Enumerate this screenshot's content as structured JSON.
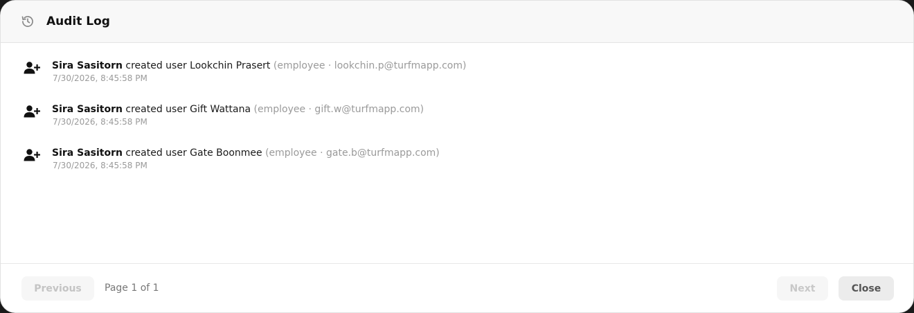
{
  "header": {
    "title": "Audit Log",
    "icon": "history-icon"
  },
  "entries": [
    {
      "icon": "user-plus-icon",
      "actor": "Sira Sasitorn",
      "action": " created user Lookchin Prasert ",
      "meta": "(employee · lookchin.p@turfmapp.com)",
      "timestamp": "7/30/2026, 8:45:58 PM"
    },
    {
      "icon": "user-plus-icon",
      "actor": "Sira Sasitorn",
      "action": " created user Gift Wattana ",
      "meta": "(employee · gift.w@turfmapp.com)",
      "timestamp": "7/30/2026, 8:45:58 PM"
    },
    {
      "icon": "user-plus-icon",
      "actor": "Sira Sasitorn",
      "action": " created user Gate Boonmee ",
      "meta": "(employee · gate.b@turfmapp.com)",
      "timestamp": "7/30/2026, 8:45:58 PM"
    }
  ],
  "footer": {
    "previous_label": "Previous",
    "page_info": "Page 1 of 1",
    "next_label": "Next",
    "close_label": "Close"
  }
}
